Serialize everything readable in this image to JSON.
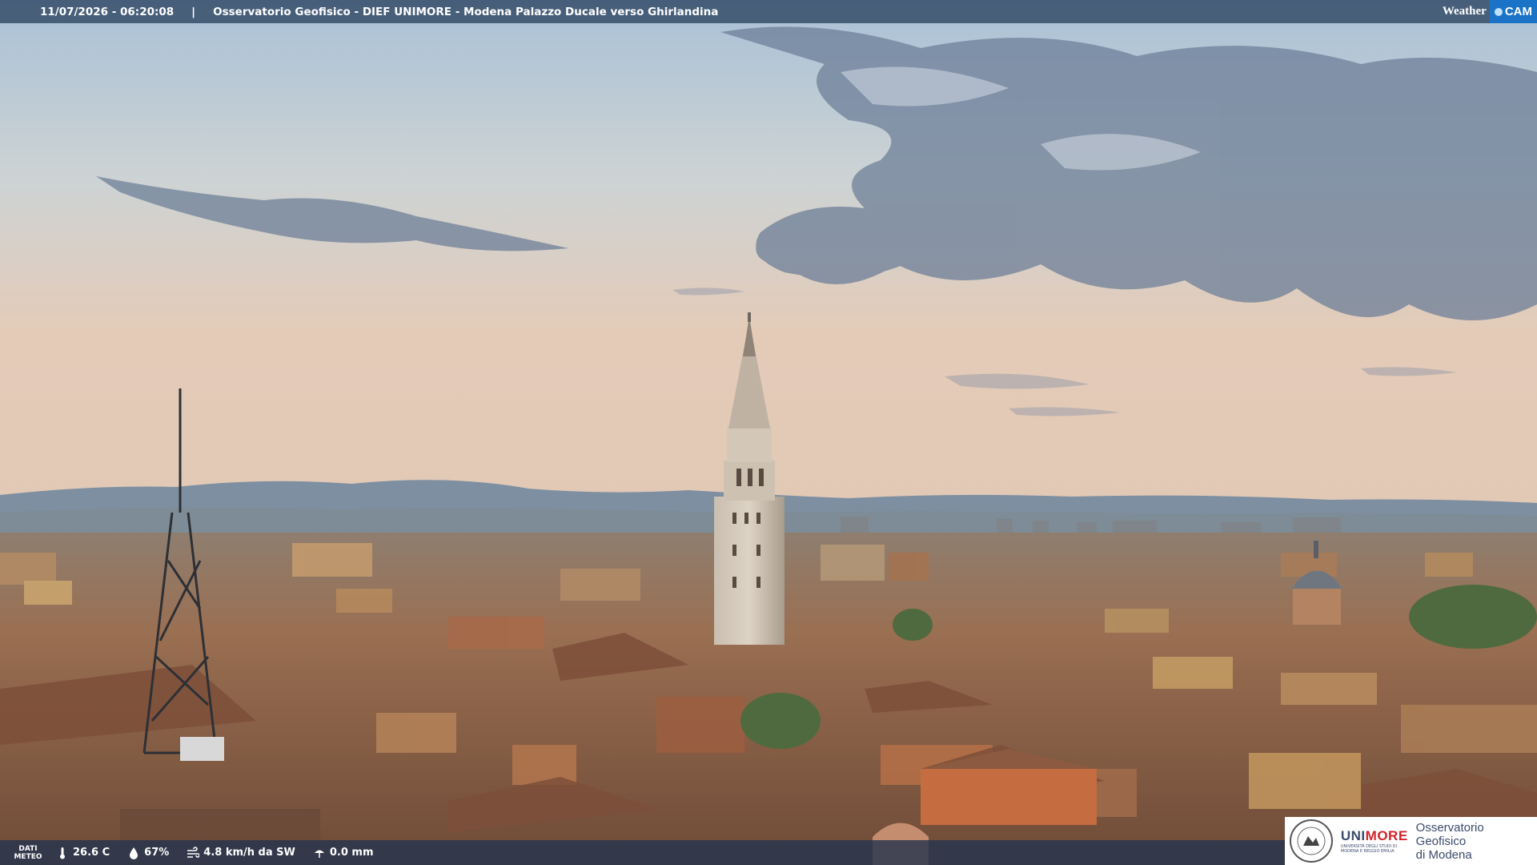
{
  "topbar": {
    "timestamp": "11/07/2026 - 06:20:08",
    "separator": "|",
    "title": "Osservatorio Geofisico - DIEF UNIMORE - Modena Palazzo Ducale verso Ghirlandina"
  },
  "brand": {
    "weather": "Weather",
    "cam": "CAM"
  },
  "meteo": {
    "label_line1": "DATI",
    "label_line2": "METEO",
    "temperature": "26.6 C",
    "humidity": "67%",
    "wind": "4.8 km/h da SW",
    "rain": "0.0 mm",
    "icons": [
      "thermometer-icon",
      "humidity-drop-icon",
      "wind-icon",
      "rain-gauge-icon"
    ]
  },
  "logo": {
    "uni": "UNI",
    "more": "MORE",
    "subtitle_line1": "UNIVERSITÀ DEGLI STUDI DI",
    "subtitle_line2": "MODENA E REGGIO EMILIA",
    "observatory_line1": "Osservatorio Geofisico",
    "observatory_line2": "di Modena"
  },
  "colors": {
    "sky_top": "#b3c8da",
    "sky_horizon": "#e3c7b3",
    "mountains": "#7b8da0",
    "roofs": "#8b5f46",
    "bar": "#2c4260",
    "brand_blue": "#1a73c6",
    "logo_red": "#d2232a"
  }
}
